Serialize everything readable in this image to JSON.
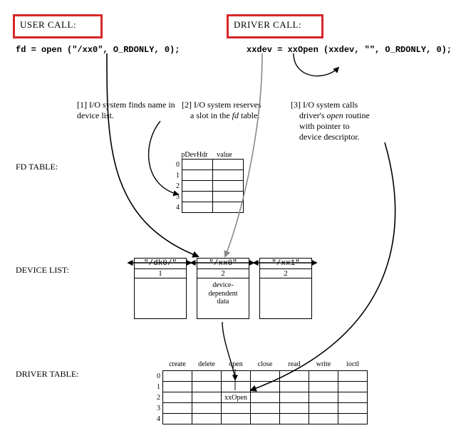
{
  "headers": {
    "user_call": "USER CALL:",
    "driver_call": "DRIVER CALL:"
  },
  "code": {
    "user": "fd = open (\"/xx0\", O_RDONLY, 0);",
    "driver": "xxdev = xxOpen (xxdev, \"\", O_RDONLY, 0);"
  },
  "steps": {
    "s1_num": "[1]",
    "s1_txt": "I/O system finds name in device list.",
    "s2_num": "[2]",
    "s2_txt_a": "I/O system reserves",
    "s2_txt_b": "a slot in the ",
    "s2_txt_b_it": "fd",
    "s2_txt_b2": " table.",
    "s3_num": "[3]",
    "s3_txt_a": "I/O system calls",
    "s3_txt_b_a": "driver's ",
    "s3_txt_b_it": "open",
    "s3_txt_b_b": " routine",
    "s3_txt_c": "with pointer to",
    "s3_txt_d": "device descriptor."
  },
  "section_labels": {
    "fd_table": "FD TABLE:",
    "device_list": "DEVICE LIST:",
    "driver_table": "DRIVER TABLE:"
  },
  "fd_table": {
    "hdr_left": "pDevHdr",
    "hdr_right": "value",
    "rows": [
      "0",
      "1",
      "2",
      "3",
      "4"
    ]
  },
  "devices": [
    {
      "name": "\"/dk0/\"",
      "num": "1",
      "body": ""
    },
    {
      "name": "\"/xx0\"",
      "num": "2",
      "body": "device-\ndependent\ndata"
    },
    {
      "name": "\"/xx1\"",
      "num": "2",
      "body": ""
    }
  ],
  "driver_table": {
    "cols": [
      "create",
      "delete",
      "open",
      "close",
      "read",
      "write",
      "ioctl"
    ],
    "rows": [
      "0",
      "1",
      "2",
      "3",
      "4"
    ],
    "cell_2_open": "xxOpen"
  }
}
